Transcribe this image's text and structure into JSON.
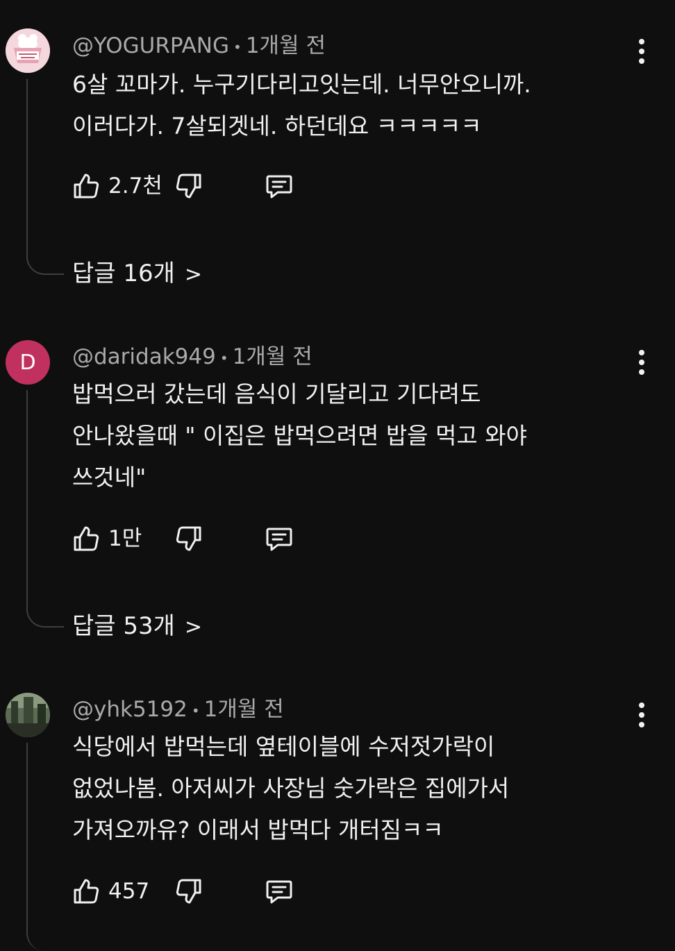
{
  "comments": [
    {
      "author": "@YOGURPANG",
      "time": "1개월 전",
      "avatar": {
        "type": "image",
        "label": "YOGURT PANG",
        "color": "#f5d7de"
      },
      "lines": [
        "6살 꼬마가. 누구기다리고잇는데. 너무안오니까.",
        "이러다가. 7살되겟네. 하던데요 ㅋㅋㅋㅋㅋ"
      ],
      "likes": "2.7천",
      "replies_label": "답글 16개",
      "more_icon": "more-vert-icon"
    },
    {
      "author": "@daridak949",
      "time": "1개월 전",
      "avatar": {
        "type": "letter",
        "letter": "D",
        "color": "#c0315f"
      },
      "lines": [
        "밥먹으러 갔는데 음식이 기달리고 기다려도",
        "안나왔을때 \" 이집은 밥먹으려면 밥을 먹고 와야",
        "쓰것네\""
      ],
      "likes": "1만",
      "replies_label": "답글 53개",
      "more_icon": "more-vert-icon"
    },
    {
      "author": "@yhk5192",
      "time": "1개월 전",
      "avatar": {
        "type": "photo",
        "color": "#5c6b55"
      },
      "lines": [
        "식당에서 밥먹는데 옆테이블에 수저젓가락이",
        "없었나봄. 아저씨가 사장님 숫가락은 집에가서",
        "가져오까유? 이래서 밥먹다 개터짐ㅋㅋ"
      ],
      "likes": "457",
      "more_icon": "more-vert-icon"
    }
  ],
  "icons": [
    "like-icon",
    "dislike-icon",
    "reply-icon",
    "more-vert-icon",
    "chevron-right-icon"
  ],
  "colors": {
    "background": "#0f0f0f",
    "text": "#f1f1f1",
    "meta": "#aaaaaa",
    "thread": "#3f3f3f"
  },
  "separator": "•",
  "chevron": ">"
}
